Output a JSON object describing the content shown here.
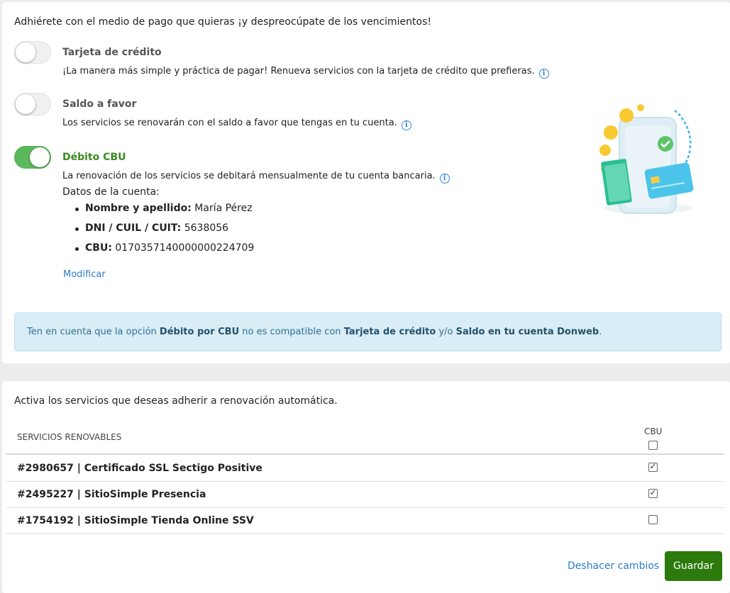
{
  "payment": {
    "intro": "Adhiérete con el medio de pago que quieras ¡y despreocúpate de los vencimientos!",
    "options": [
      {
        "title": "Tarjeta de crédito",
        "desc": "¡La manera más simple y práctica de pagar! Renueva servicios con la tarjeta de crédito que prefieras.",
        "enabled": false
      },
      {
        "title": "Saldo a favor",
        "desc": "Los servicios se renovarán con el saldo a favor que tengas en tu cuenta.",
        "enabled": false
      },
      {
        "title": "Débito CBU",
        "desc": "La renovación de los servicios se debitará mensualmente de tu cuenta bancaria.",
        "enabled": true
      }
    ],
    "account": {
      "label": "Datos de la cuenta:",
      "fields": [
        {
          "label": "Nombre y apellido:",
          "value": "María Pérez"
        },
        {
          "label": "DNI / CUIL / CUIT:",
          "value": "5638056"
        },
        {
          "label": "CBU:",
          "value": "0170357140000000224709"
        }
      ],
      "modify_link": "Modificar"
    },
    "notice": {
      "part1": "Ten en cuenta que la opción ",
      "b1": "Débito por CBU",
      "part2": " no es compatible con ",
      "b2": "Tarjeta de crédito",
      "part3": " y/o ",
      "b3": "Saldo en tu cuenta Donweb",
      "part4": "."
    }
  },
  "services": {
    "title": "Activa los servicios que deseas adherir a renovación automática.",
    "col_header": "SERVICIOS RENOVABLES",
    "cbu_col": "CBU",
    "rows": [
      {
        "name": "#2980657 | Certificado SSL Sectigo Positive",
        "checked": true
      },
      {
        "name": "#2495227 | SitioSimple Presencia",
        "checked": true
      },
      {
        "name": "#1754192 | SitioSimple Tienda Online SSV",
        "checked": false
      }
    ]
  },
  "actions": {
    "undo": "Deshacer cambios",
    "save": "Guardar"
  },
  "colors": {
    "accent_green": "#2b7a0b",
    "toggle_on": "#5cb85c",
    "link_blue": "#2d7ccd",
    "notice_bg": "#d9edf7"
  }
}
